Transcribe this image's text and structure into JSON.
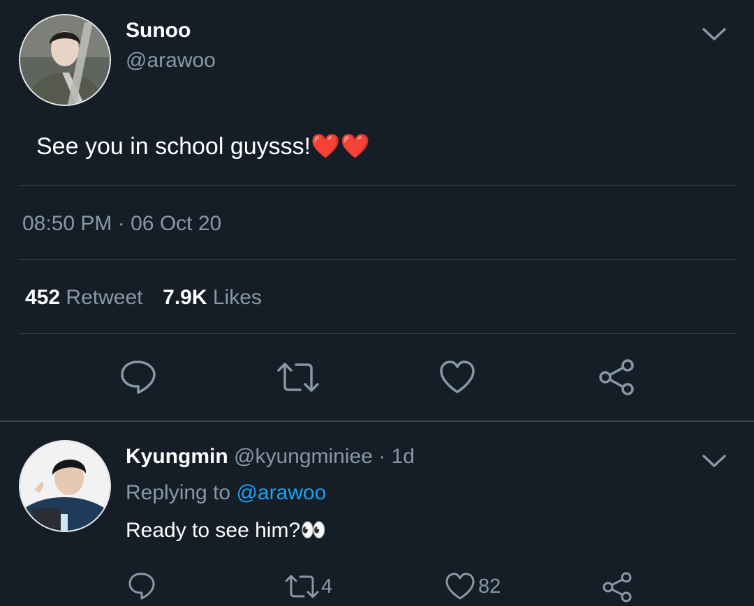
{
  "tweet": {
    "author_name": "Sunoo",
    "author_handle": "@arawoo",
    "text": "See you in school guysss!",
    "emoji": "❤️❤️",
    "time": "08:50 PM",
    "separator": "·",
    "date": "06 Oct 20",
    "retweet_count": "452",
    "retweet_label": "Retweet",
    "like_count": "7.9K",
    "like_label": "Likes"
  },
  "reply": {
    "author_name": "Kyungmin",
    "author_handle": "@kyungminiee",
    "separator": "·",
    "age": "1d",
    "replying_label": "Replying to",
    "replying_handle": "@arawoo",
    "text": "Ready to see him?",
    "emoji": "👀",
    "retweet_count": "4",
    "like_count": "82"
  },
  "colors": {
    "background": "#151d27",
    "muted": "#8899a6",
    "divider": "#38444d",
    "link": "#1da1f2"
  }
}
